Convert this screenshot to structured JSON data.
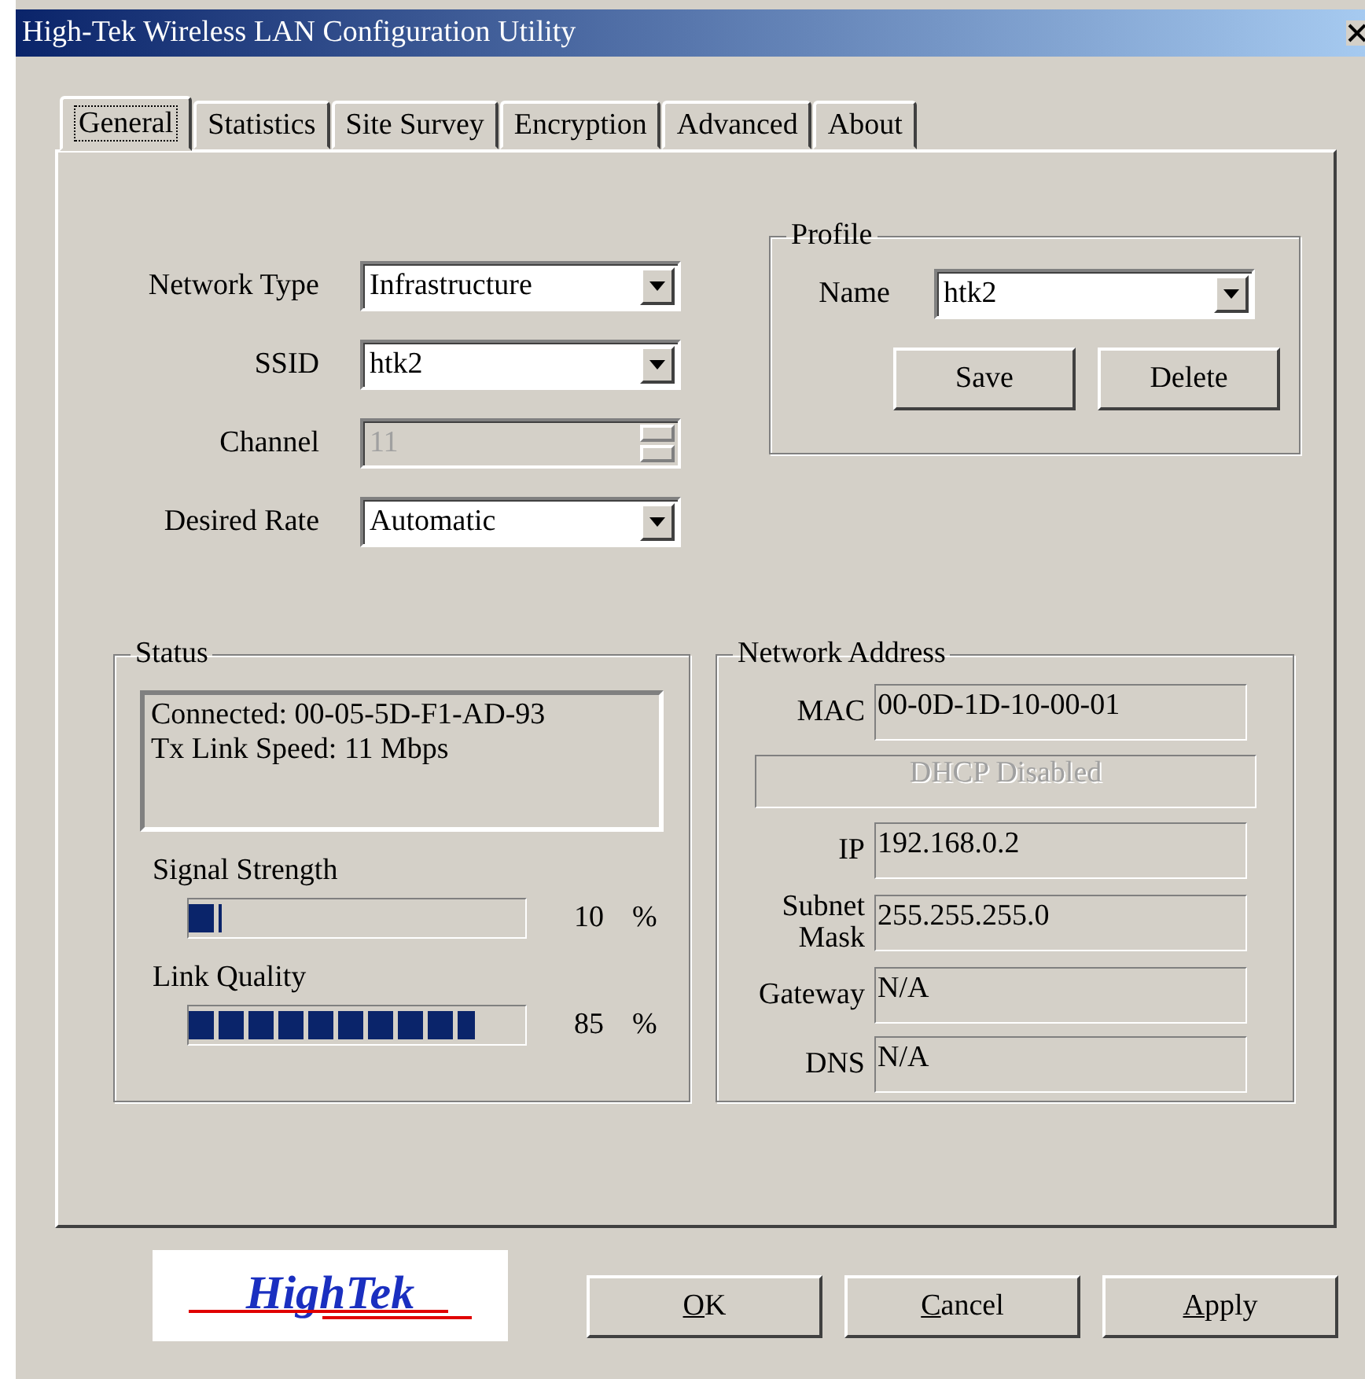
{
  "window": {
    "title": "High-Tek Wireless LAN Configuration Utility"
  },
  "tabs": [
    {
      "label": "General",
      "selected": true
    },
    {
      "label": "Statistics",
      "selected": false
    },
    {
      "label": "Site Survey",
      "selected": false
    },
    {
      "label": "Encryption",
      "selected": false
    },
    {
      "label": "Advanced",
      "selected": false
    },
    {
      "label": "About",
      "selected": false
    }
  ],
  "settings": [
    {
      "label": "Network Type",
      "value": "Infrastructure",
      "kind": "dropdown",
      "disabled": false
    },
    {
      "label": "SSID",
      "value": "htk2",
      "kind": "dropdown",
      "disabled": false
    },
    {
      "label": "Channel",
      "value": "11",
      "kind": "spinner",
      "disabled": true
    },
    {
      "label": "Desired Rate",
      "value": "Automatic",
      "kind": "dropdown",
      "disabled": false
    }
  ],
  "profile": {
    "title": "Profile",
    "name_label": "Name",
    "name_value": "htk2",
    "buttons": [
      "Save",
      "Delete"
    ]
  },
  "status": {
    "title": "Status",
    "lines": [
      "Connected: 00-05-5D-F1-AD-93",
      "Tx Link Speed: 11 Mbps"
    ],
    "meters": [
      {
        "label": "Signal Strength",
        "level": 0.1,
        "reading": "10",
        "unit": "%"
      },
      {
        "label": "Link Quality",
        "level": 0.85,
        "reading": "85",
        "unit": "%"
      }
    ]
  },
  "network_address": {
    "title": "Network Address",
    "fields": [
      {
        "kind": "field",
        "label": "MAC",
        "value": "00-0D-1D-10-00-01"
      },
      {
        "kind": "notice",
        "value": "DHCP Disabled"
      },
      {
        "kind": "field",
        "label": "IP",
        "value": "192.168.0.2"
      },
      {
        "kind": "field",
        "label": "Subnet Mask",
        "value": "255.255.255.0"
      },
      {
        "kind": "field",
        "label": "Gateway",
        "value": "N/A"
      },
      {
        "kind": "field",
        "label": "DNS",
        "value": "N/A"
      }
    ]
  },
  "logo": {
    "text": "HighTek"
  },
  "buttons": [
    {
      "key": "O",
      "rest": "K"
    },
    {
      "key": "C",
      "rest": "ancel"
    },
    {
      "key": "A",
      "rest": "pply"
    }
  ]
}
